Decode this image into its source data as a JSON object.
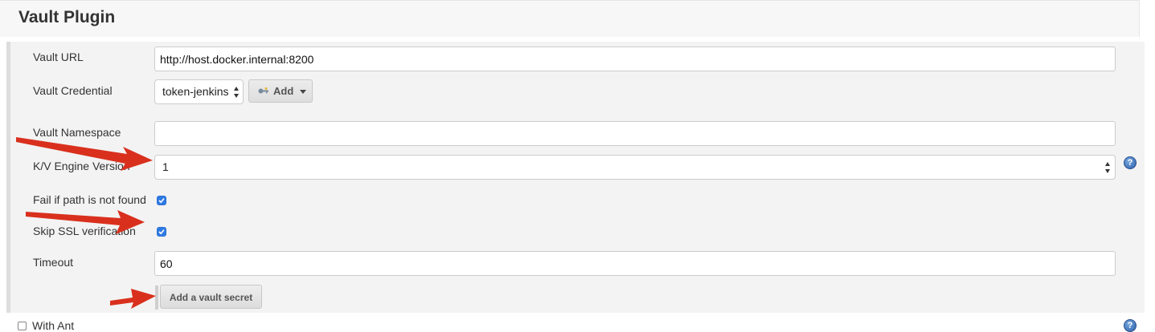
{
  "section": {
    "title": "Vault Plugin"
  },
  "fields": {
    "vault_url": {
      "label": "Vault URL",
      "value": "http://host.docker.internal:8200"
    },
    "vault_credential": {
      "label": "Vault Credential",
      "selected": "token-jenkins",
      "add_label": "Add",
      "add_icon": "key-icon"
    },
    "vault_namespace": {
      "label": "Vault Namespace",
      "value": ""
    },
    "kv_engine_version": {
      "label": "K/V Engine Version",
      "selected": "1"
    },
    "fail_if_not_found": {
      "label": "Fail if path is not found",
      "checked": true
    },
    "skip_ssl": {
      "label": "Skip SSL verification",
      "checked": true
    },
    "timeout": {
      "label": "Timeout",
      "value": "60"
    }
  },
  "buttons": {
    "add_secret": "Add a vault secret"
  },
  "next_section": {
    "label": "With Ant",
    "checked": false
  },
  "colors": {
    "accent": "#2f7be4",
    "annotation_arrow": "#d9301d",
    "panel_bg": "#f3f3f3"
  },
  "icons": {
    "help": "help-icon",
    "key": "key-icon",
    "checkbox": "check-icon"
  }
}
